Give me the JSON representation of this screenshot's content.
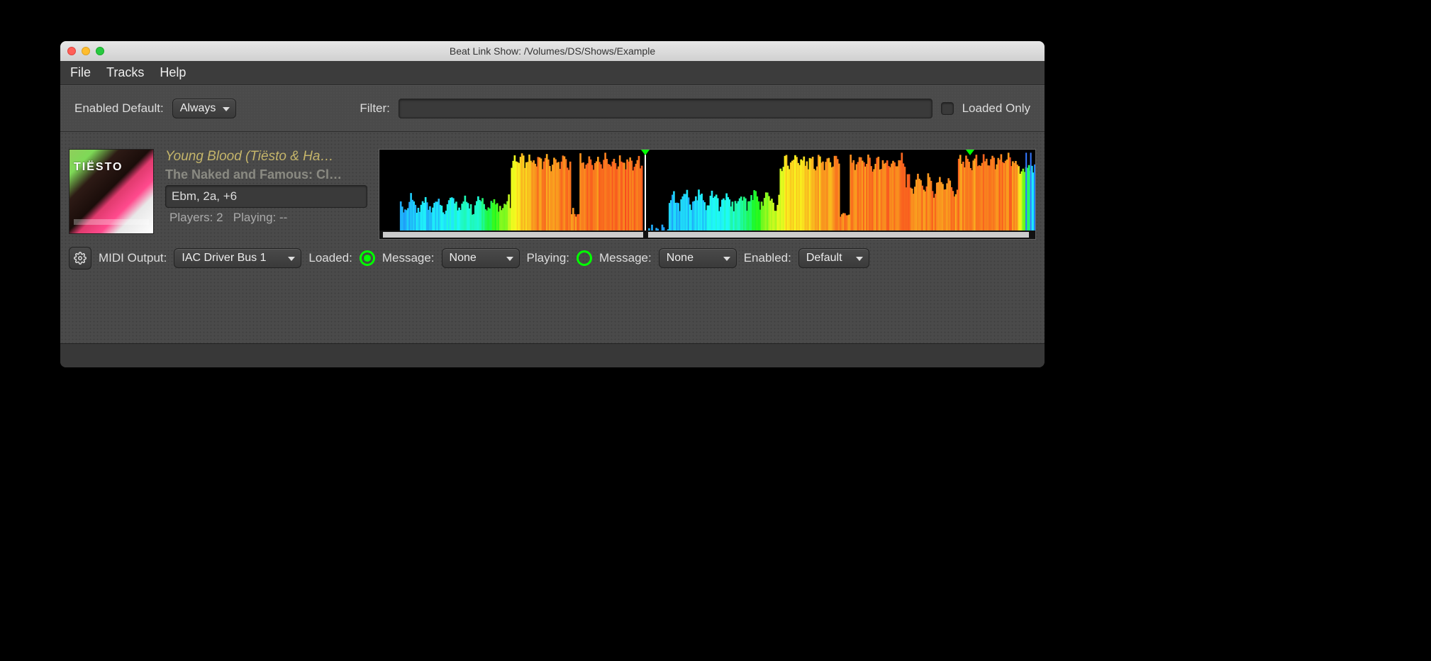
{
  "window_title": "Beat Link Show: /Volumes/DS/Shows/Example",
  "menu": {
    "file": "File",
    "tracks": "Tracks",
    "help": "Help"
  },
  "toolbar": {
    "enabled_default_label": "Enabled Default:",
    "enabled_default_value": "Always",
    "filter_label": "Filter:",
    "filter_value": "",
    "loaded_only_label": "Loaded Only"
  },
  "track": {
    "title": "Young Blood (Tiësto & Ha…",
    "artist": "The Naked and Famous: Cl…",
    "comment": "Ebm, 2a, +6",
    "players_label": "Players:",
    "players_value": "2",
    "playing_label": "Playing:",
    "playing_value": "--",
    "controls": {
      "midi_output_label": "MIDI Output:",
      "midi_output_value": "IAC Driver Bus 1",
      "loaded_label": "Loaded:",
      "loaded_message_label": "Message:",
      "loaded_message_value": "None",
      "playing_label": "Playing:",
      "playing_message_label": "Message:",
      "playing_message_value": "None",
      "enabled_label": "Enabled:",
      "enabled_value": "Default"
    },
    "playheads": [
      40.5,
      90.0
    ]
  }
}
